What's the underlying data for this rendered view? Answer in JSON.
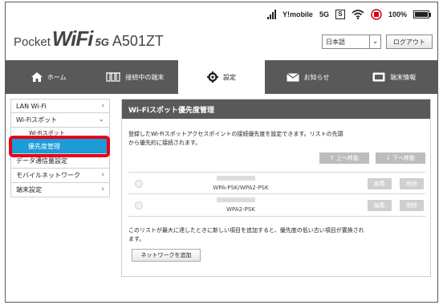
{
  "header": {
    "brand_pocket": "Pocket",
    "brand_wifi": "WiFi",
    "brand_5g": "5G",
    "brand_model": "A501ZT",
    "carrier": "Y!mobile",
    "network": "5G",
    "sim_label": "S",
    "battery": "100%",
    "battery_level": 1.0,
    "language_value": "日本語",
    "logout_label": "ログアウト"
  },
  "nav": {
    "items": [
      {
        "label": "ホーム",
        "icon": "home-icon"
      },
      {
        "label": "接続中の端末",
        "icon": "devices-icon"
      },
      {
        "label": "設定",
        "icon": "gear-icon"
      },
      {
        "label": "お知らせ",
        "icon": "mail-icon"
      },
      {
        "label": "端末情報",
        "icon": "device-info-icon"
      }
    ],
    "active_index": 2
  },
  "sidebar": {
    "items": [
      {
        "label": "LAN Wi-Fi"
      },
      {
        "label": "Wi-Fiスポット"
      },
      {
        "label": "Wi-Fiスポット"
      },
      {
        "label": "優先度管理"
      },
      {
        "label": "データ通信量設定"
      },
      {
        "label": "モバイルネットワーク"
      },
      {
        "label": "端末設定"
      }
    ]
  },
  "main": {
    "title": "Wi-Fiスポット優先度管理",
    "description": "登録したWi-Fiスポットアクセスポイントの接続優先度を設定できます。リストの先頭から優先的に接続されます。",
    "move_up_label": "↑ 上へ移動",
    "move_down_label": "↓ 下へ移動",
    "access_points": [
      {
        "security": "WPA-PSK/WPA2-PSK",
        "edit_label": "編集",
        "delete_label": "削除"
      },
      {
        "security": "WPA2-PSK",
        "edit_label": "編集",
        "delete_label": "削除"
      }
    ],
    "note": "このリストが最大に達したときに新しい項目を追加すると、優先度の低い古い項目が置換されます。",
    "add_network_label": "ネットワークを追加"
  },
  "colors": {
    "nav_bg": "#595959",
    "active_blue": "#1b9bd8",
    "highlight_red": "#e8001b"
  }
}
